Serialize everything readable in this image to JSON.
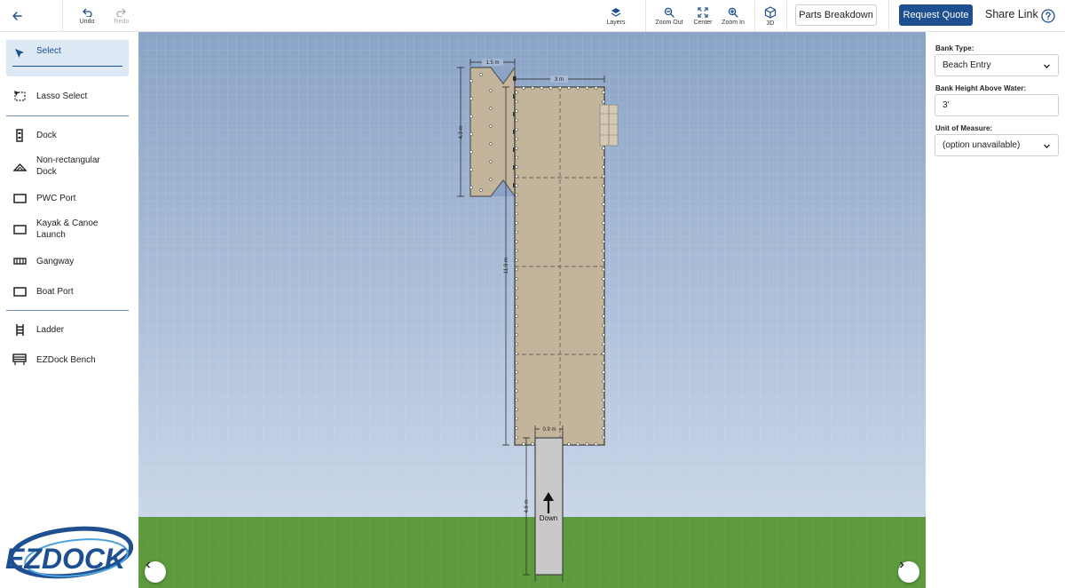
{
  "toolbar": {
    "undo_label": "Undo",
    "redo_label": "Redo",
    "layers_label": "Layers",
    "zoom_out_label": "Zoom Out",
    "center_label": "Center",
    "zoom_in_label": "Zoom In",
    "view3d_label": "3D",
    "parts_breakdown_label": "Parts Breakdown",
    "request_quote_label": "Request Quote",
    "share_link_label": "Share Link"
  },
  "sidebar": {
    "tools": [
      {
        "label": "Select",
        "icon": "cursor-icon",
        "selected": true
      },
      {
        "label": "Lasso Select",
        "icon": "lasso-icon"
      },
      {
        "label": "Dock",
        "icon": "dock-icon"
      },
      {
        "label": "Non-rectangular Dock",
        "icon": "non-rect-dock-icon"
      },
      {
        "label": "PWC Port",
        "icon": "pwc-port-icon"
      },
      {
        "label": "Kayak & Canoe Launch",
        "icon": "kayak-launch-icon"
      },
      {
        "label": "Gangway",
        "icon": "gangway-icon"
      },
      {
        "label": "Boat Port",
        "icon": "boat-port-icon"
      },
      {
        "label": "Ladder",
        "icon": "ladder-icon"
      },
      {
        "label": "EZDock Bench",
        "icon": "bench-icon"
      }
    ],
    "logo_text": "EZDOCK"
  },
  "canvas": {
    "dimensions": {
      "top_width": "1.5 m",
      "dock_width": "3 m",
      "left_height": "4.3 m",
      "dock_length": "11.9 m",
      "gangway_width": "0.9 m",
      "gangway_length": "4.6 m"
    },
    "gangway_direction_label": "Down",
    "colors": {
      "water_top": "#8aa3c6",
      "water_bottom": "#c9d6e8",
      "grass": "#5c9a3c",
      "dock_fill": "#c2b59b",
      "gangway_fill": "#c9c9c9"
    }
  },
  "properties": {
    "bank_type_label": "Bank Type:",
    "bank_type_value": "Beach Entry",
    "bank_height_label": "Bank Height Above Water:",
    "bank_height_value": "3'",
    "unit_label": "Unit of Measure:",
    "unit_value": "(option unavailable)"
  }
}
